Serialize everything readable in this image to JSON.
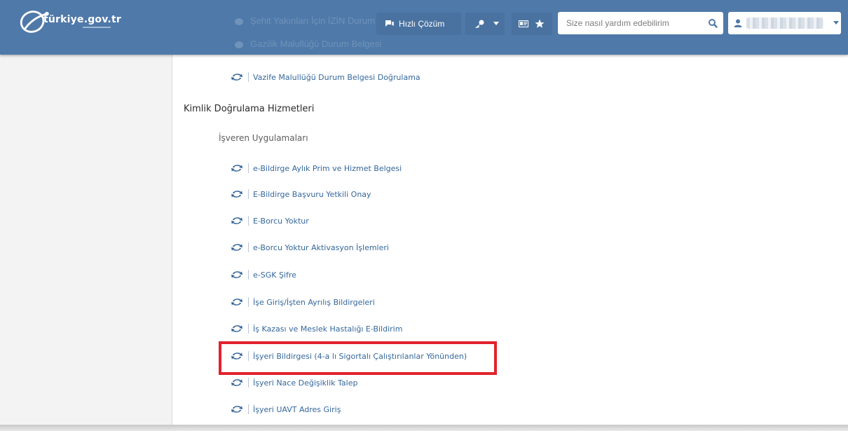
{
  "header": {
    "logo_text": "türkiye.gov.tr",
    "ghost_items": [
      "Şehit Yakınları İçin İZİN Durum Belgesi",
      "Gazilik Malullüğü Durum Belgesi"
    ],
    "quick_solution_label": "Hızlı Çözüm",
    "search_placeholder": "Size nasıl yardım edebilirim",
    "icons": [
      "logo-icon",
      "chat-icon",
      "key-icon",
      "caret-down-icon",
      "id-card-icon",
      "star-icon",
      "search-icon",
      "user-icon"
    ]
  },
  "content": {
    "top_links": [
      {
        "label": "Vazife Malullüğü Durum Belgesi Doğrulama"
      }
    ],
    "section_title": "Kimlik Doğrulama Hizmetleri",
    "subsection_title": "İşveren Uygulamaları",
    "links": [
      {
        "label": "e-Bildirge Aylık Prim ve Hizmet Belgesi"
      },
      {
        "label": "E-Bildirge Başvuru Yetkili Onay"
      },
      {
        "label": "E-Borcu Yoktur"
      },
      {
        "label": "e-Borcu Yoktur Aktivasyon İşlemleri"
      },
      {
        "label": "e-SGK Şifre"
      },
      {
        "label": "İşe Giriş/İşten Ayrılış Bildirgeleri"
      },
      {
        "label": "İş Kazası ve Meslek Hastalığı E-Bildirim"
      },
      {
        "label": "İşyeri Bildirgesi (4-a lı Sigortalı Çalıştırılanlar Yönünden)"
      },
      {
        "label": "İşyeri Nace Değişiklik Talep"
      },
      {
        "label": "İşyeri UAVT Adres Giriş"
      }
    ],
    "highlighted_index": 7
  },
  "colors": {
    "header_bg": "#4f79a9",
    "link": "#35679c",
    "highlight_border": "#e2222c",
    "sidebar_bg": "#f3f3f3"
  }
}
